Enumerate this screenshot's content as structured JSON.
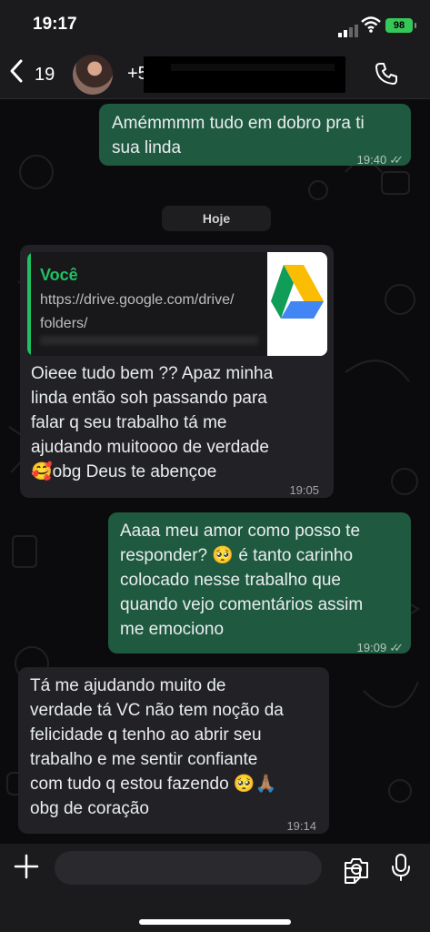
{
  "status_bar": {
    "time": "19:17",
    "battery": "98"
  },
  "header": {
    "back_count": "19",
    "contact_prefix": "+5"
  },
  "messages": [
    {
      "direction": "out",
      "lines": [
        "Amémmmm tudo em dobro pra ti",
        "sua linda"
      ],
      "time": "19:40",
      "ticks": "✓✓"
    },
    {
      "direction": "date",
      "label": "Hoje"
    },
    {
      "direction": "in",
      "quote_author": "Você",
      "quote_lines": [
        "https://drive.google.com/drive/",
        "folders/"
      ],
      "lines": [
        "Oieee tudo bem ?? Apaz minha",
        "linda então soh passando para",
        "falar q seu trabalho tá me",
        "ajudando muitoooo de verdade",
        "🥰obg Deus te abençoe"
      ],
      "time": "19:05"
    },
    {
      "direction": "out",
      "lines": [
        "Aaaa meu amor como posso te",
        "responder? 🥺 é tanto carinho",
        "colocado nesse trabalho que",
        "quando vejo comentários assim",
        "me emociono"
      ],
      "time": "19:09",
      "ticks": "✓✓"
    },
    {
      "direction": "in",
      "lines": [
        "Tá me ajudando muito de",
        "verdade tá VC não tem noção da",
        "felicidade q tenho ao abrir seu",
        "trabalho e me sentir confiante",
        "com tudo q estou fazendo 🥺🙏🏽",
        "obg de coração"
      ],
      "time": "19:14"
    }
  ],
  "colors": {
    "outgoing": "#1f5a40",
    "incoming": "#222226",
    "accent": "#20c063"
  },
  "icons": {
    "back": "chevron-left-icon",
    "call": "phone-icon",
    "attach": "plus-icon",
    "sticker": "sticker-icon",
    "camera": "camera-icon",
    "mic": "mic-icon"
  }
}
